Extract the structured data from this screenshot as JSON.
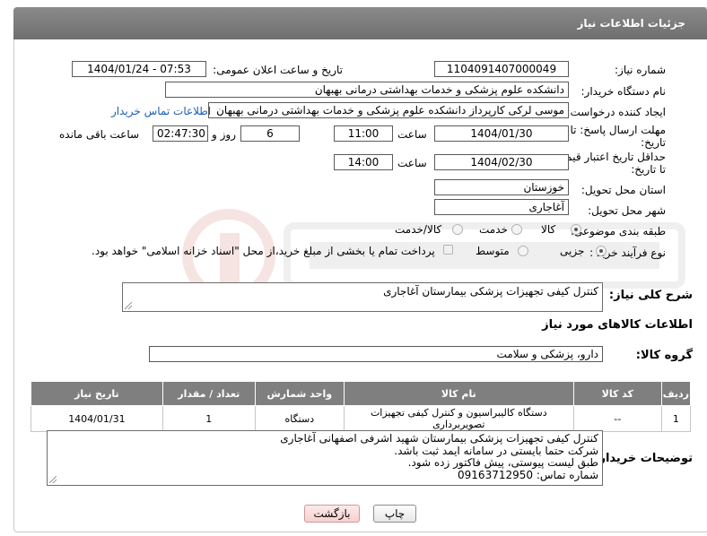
{
  "header": {
    "title": "جزئیات اطلاعات نیاز"
  },
  "need_number": {
    "label": "شماره نیاز:",
    "value": "1104091407000049"
  },
  "announce_datetime": {
    "label": "تاریخ و ساعت اعلان عمومی:",
    "value": "1404/01/24 - 07:53"
  },
  "buyer_org": {
    "label": "نام دستگاه خریدار:",
    "value": "دانشکده علوم پزشکی و خدمات بهداشتی  درمانی بهبهان"
  },
  "creator": {
    "label": "ایجاد کننده درخواست:",
    "value": "موسی لرکی کارپرداز دانشکده علوم پزشکی و خدمات بهداشتی  درمانی بهبهان",
    "contact_link": "اطلاعات تماس خریدار"
  },
  "deadline": {
    "label_line1": "مهلت ارسال پاسخ: تا",
    "label_line2": "تاریخ:",
    "date": "1404/01/30",
    "time_label": "ساعت",
    "time": "11:00",
    "days": "6",
    "days_label": "روز و",
    "remaining": "02:47:30",
    "remaining_label": "ساعت باقی مانده"
  },
  "price_validity": {
    "label_line1": "حداقل تاریخ اعتبار قیمت:",
    "label_line2": "تا تاریخ:",
    "date": "1404/02/30",
    "time_label": "ساعت",
    "time": "14:00"
  },
  "province": {
    "label": "استان محل تحویل:",
    "value": "خوزستان"
  },
  "city": {
    "label": "شهر محل تحویل:",
    "value": "آغاجاری"
  },
  "category": {
    "label": "طبقه بندی موضوعی:",
    "options": [
      "کالا",
      "خدمت",
      "کالا/خدمت"
    ],
    "selected": "کالا"
  },
  "purchase_type": {
    "label": "نوع فرآیند خرید :",
    "options": [
      "جزیی",
      "متوسط"
    ],
    "selected": "جزیی",
    "treasury_note": "پرداخت تمام یا بخشی از مبلغ خرید،از محل \"اسناد خزانه اسلامی\" خواهد بود."
  },
  "summary": {
    "label": "شرح کلی نیاز:",
    "value": "کنترل کیفی تجهیزات پزشکی بیمارستان آغاجاری"
  },
  "goods_info_title": "اطلاعات کالاهای مورد نیاز",
  "goods_group": {
    "label": "گروه کالا:",
    "value": "دارو، پزشکی و سلامت"
  },
  "table": {
    "headers": [
      "ردیف",
      "کد کالا",
      "نام کالا",
      "واحد شمارش",
      "تعداد / مقدار",
      "تاریخ نیاز"
    ],
    "rows": [
      [
        "1",
        "--",
        "دستگاه کالیبراسیون و کنترل کیفی تجهیزات تصویربرداری",
        "دستگاه",
        "1",
        "1404/01/31"
      ]
    ]
  },
  "buyer_notes": {
    "label": "توضیحات خریدار:",
    "lines": [
      "کنترل کیفی تجهیزات پزشکی بیمارستان شهید اشرفی اصفهانی آغاجاری",
      "شرکت حتما بایستی در سامانه ایمد ثبت باشد.",
      "طبق لیست پیوستی، پیش فاکتور زده شود.",
      "شماره تماس: 09163712950"
    ]
  },
  "buttons": {
    "print": "چاپ",
    "back": "بازگشت"
  },
  "colors": {
    "header_bg": "#777777",
    "link": "#1a5fb4",
    "back_button": "#f7cfcf"
  }
}
